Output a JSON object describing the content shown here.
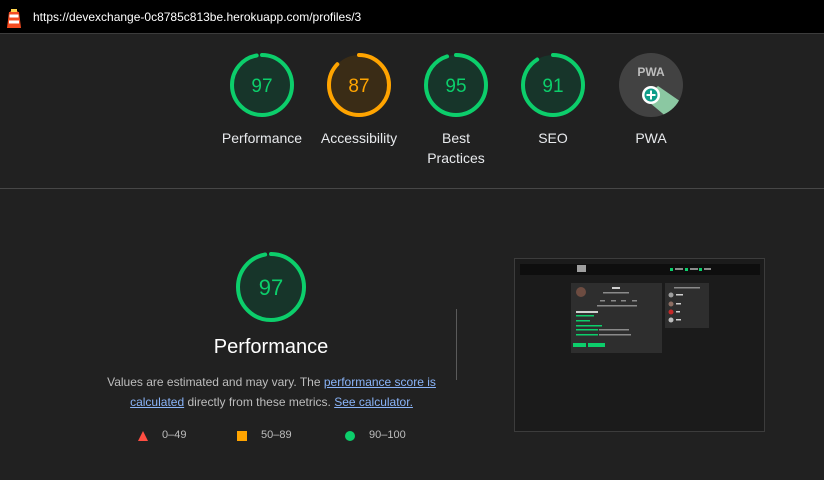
{
  "browser": {
    "url": "https://devexchange-0c8785c813be.herokuapp.com/profiles/3"
  },
  "colors": {
    "pass": "#0cce6b",
    "average": "#ffa400",
    "fail": "#ff4e42",
    "pwa": "#9e9e9e"
  },
  "categories": [
    {
      "score": "97",
      "label": "Performance",
      "level": "pass",
      "value": 97
    },
    {
      "score": "87",
      "label": "Accessibility",
      "level": "average",
      "value": 87
    },
    {
      "score": "95",
      "label": "Best",
      "label2": "Practices",
      "level": "pass",
      "value": 95
    },
    {
      "score": "91",
      "label": "SEO",
      "level": "pass",
      "value": 91
    },
    {
      "badge": "PWA",
      "label": "PWA",
      "icon": "pwa-installable-icon"
    }
  ],
  "performance": {
    "score": "97",
    "value": 97,
    "title": "Performance",
    "desc_prefix": "Values are estimated and may vary. The ",
    "link_score": "performance score is calculated",
    "desc_middle": " directly from these metrics. ",
    "link_calc": "See calculator."
  },
  "legend": [
    {
      "range": "0–49",
      "shape": "triangle",
      "color": "#ff4e42"
    },
    {
      "range": "50–89",
      "shape": "square",
      "color": "#ffa400"
    },
    {
      "range": "90–100",
      "shape": "circle",
      "color": "#0cce6b"
    }
  ],
  "screenshot": {
    "description": "page-thumbnail"
  }
}
